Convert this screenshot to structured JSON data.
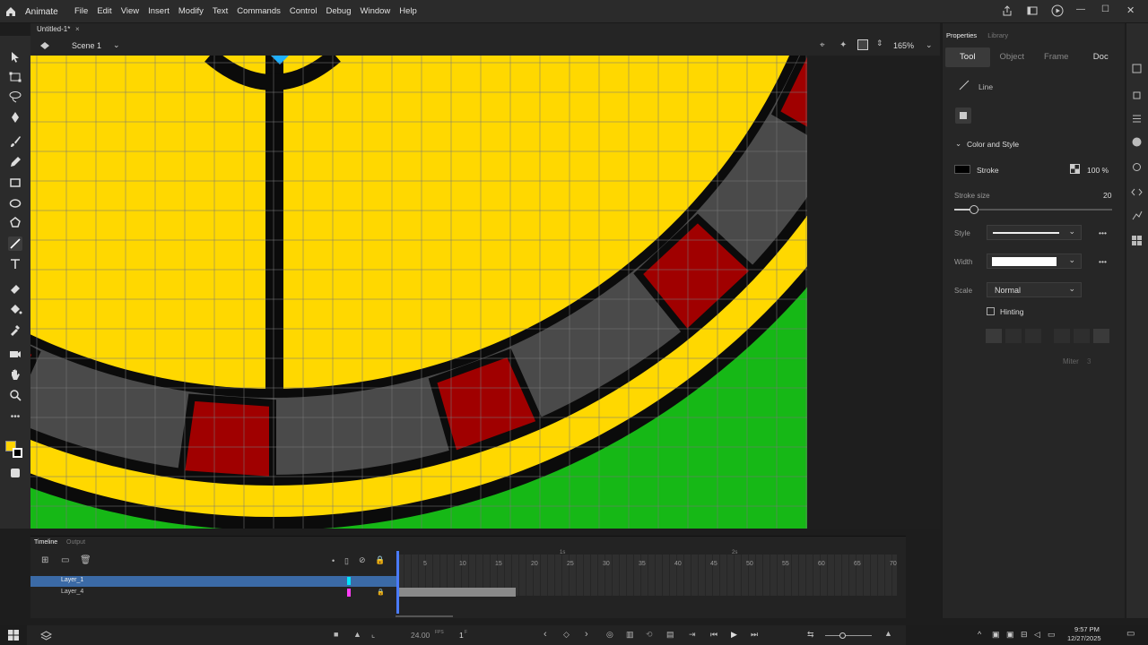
{
  "app": {
    "name": "Animate"
  },
  "menu": [
    "File",
    "Edit",
    "View",
    "Insert",
    "Modify",
    "Text",
    "Commands",
    "Control",
    "Debug",
    "Window",
    "Help"
  ],
  "document": {
    "tab": "Untitled-1*",
    "close": "×"
  },
  "scene": {
    "name": "Scene 1",
    "zoom": "165%"
  },
  "panel": {
    "tabs": [
      "Properties",
      "Library"
    ],
    "subtabs": [
      "Tool",
      "Object",
      "Frame",
      "Doc"
    ],
    "tool_name": "Line",
    "section": "Color and Style",
    "stroke_label": "Stroke",
    "stroke_color": "#000000",
    "stroke_alpha": "100 %",
    "stroke_size_label": "Stroke size",
    "stroke_size": "20",
    "style_label": "Style",
    "width_label": "Width",
    "scale_label": "Scale",
    "scale_value": "Normal",
    "hinting_label": "Hinting",
    "miter_label": "Miter",
    "miter_value": "3"
  },
  "timeline": {
    "tabs": [
      "Timeline",
      "Output"
    ],
    "layers": [
      {
        "name": "Layer_1",
        "selected": true,
        "color": "#00e5ff"
      },
      {
        "name": "Layer_4",
        "selected": false,
        "color": "#ff3df5"
      }
    ],
    "frame_ticks": [
      "5",
      "10",
      "15",
      "20",
      "25",
      "30",
      "35",
      "40",
      "45",
      "50",
      "55",
      "60",
      "65",
      "70"
    ],
    "ruler_marks": [
      "1s",
      "2s"
    ],
    "fps": "24.00",
    "fps_unit": "FPS",
    "current_frame": "1",
    "frame_unit": "F"
  },
  "taskbar": {
    "time": "9:57 PM",
    "date": "12/27/2025"
  },
  "colors": {
    "fill": "#ffd400",
    "stage_bg": "#16b816",
    "yellow": "#ffd800",
    "red": "#a00000",
    "gray": "#4a4a4a",
    "accent": "#3b6aa6"
  }
}
